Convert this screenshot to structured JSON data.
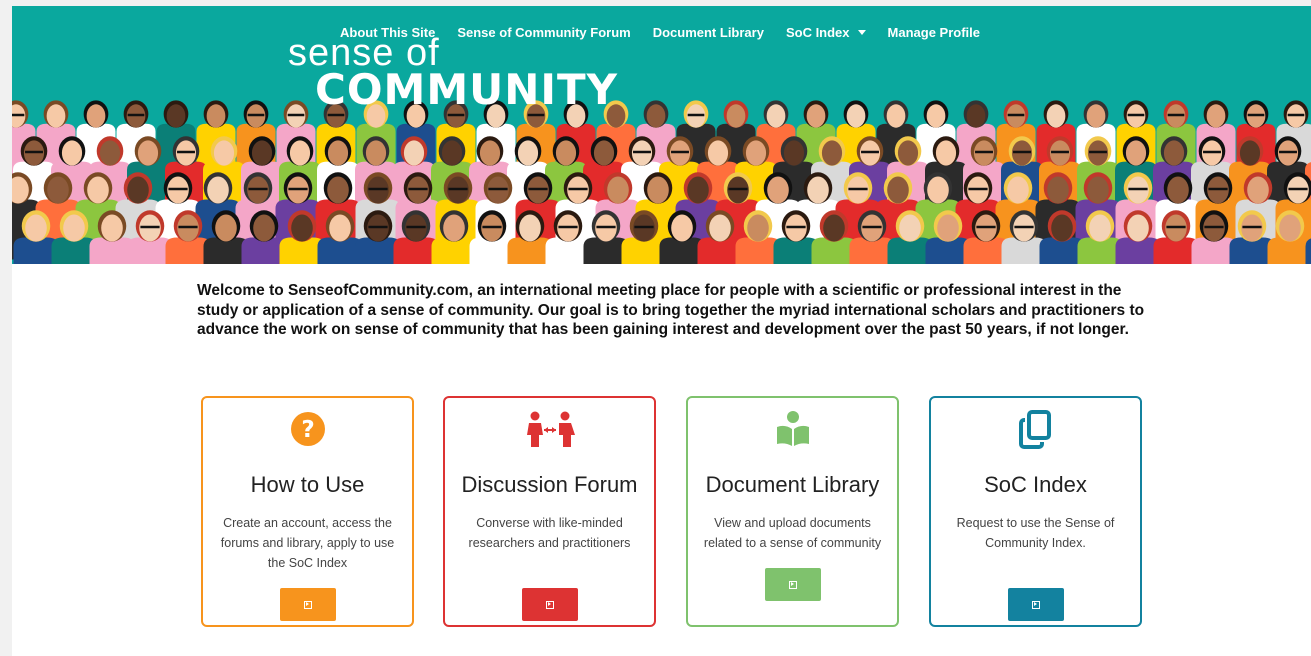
{
  "logo": {
    "line1": "sense of",
    "line2": "COMMUNITY"
  },
  "nav": {
    "items": [
      {
        "label": "About This Site"
      },
      {
        "label": "Sense of Community Forum"
      },
      {
        "label": "Document Library"
      },
      {
        "label": "SoC Index"
      },
      {
        "label": "Manage Profile"
      }
    ]
  },
  "intro": "Welcome to SenseofCommunity.com, an international meeting place for people with a scientific or professional interest in the study or application of a sense of community. Our goal is to bring together the myriad international scholars and practitioners to advance the work on sense of community that has been gaining interest and development over the past 50 years, if not longer.",
  "cards": [
    {
      "title": "How to Use",
      "description": "Create an account, access the forums and library, apply to use the SoC Index",
      "icon": "question-circle-icon",
      "color": "#f7941d"
    },
    {
      "title": "Discussion Forum",
      "description": "Converse with like-minded researchers and practitioners",
      "icon": "people-exchange-icon",
      "color": "#dd3333"
    },
    {
      "title": "Document Library",
      "description": "View and upload documents related to a sense of community",
      "icon": "reader-book-icon",
      "color": "#7fc26d"
    },
    {
      "title": "SoC Index",
      "description": "Request to use the Sense of Community Index.",
      "icon": "copy-documents-icon",
      "color": "#13829f"
    }
  ],
  "colors": {
    "hero": "#0aa89e"
  }
}
